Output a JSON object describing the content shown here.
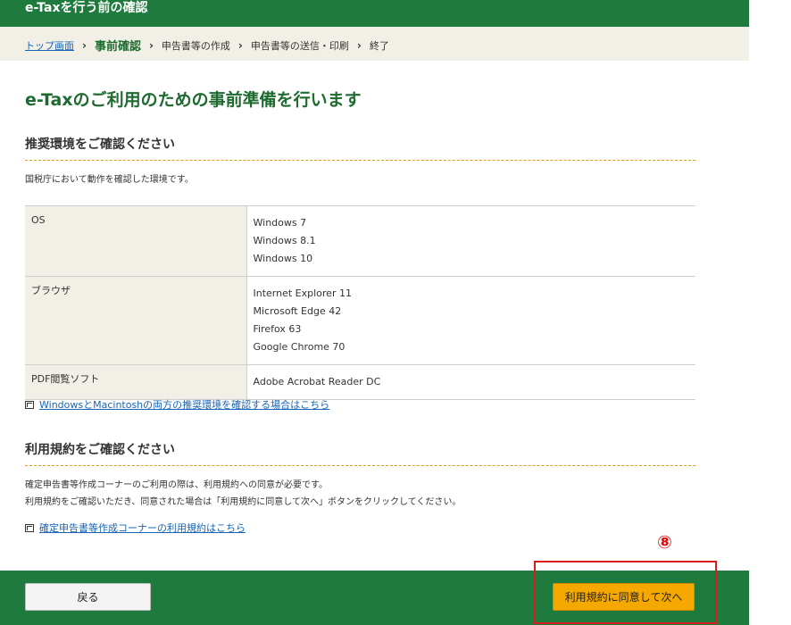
{
  "header": {
    "title": "e-Taxを行う前の確認"
  },
  "breadcrumb": {
    "top_link": "トップ画面",
    "current": "事前確認",
    "step2": "申告書等の作成",
    "step3": "申告書等の送信・印刷",
    "step4": "終了",
    "separator": "›"
  },
  "page": {
    "title": "e-Taxのご利用のための事前準備を行います"
  },
  "env_section": {
    "title": "推奨環境をご確認ください",
    "description": "国税庁において動作を確認した環境です。",
    "rows": [
      {
        "key": "OS",
        "values": [
          "Windows 7",
          "Windows 8.1",
          "Windows 10"
        ]
      },
      {
        "key": "ブラウザ",
        "values": [
          "Internet Explorer 11",
          "Microsoft Edge 42",
          "Firefox 63",
          "Google Chrome 70"
        ]
      },
      {
        "key": "PDF閲覧ソフト",
        "values": [
          "Adobe Acrobat Reader DC"
        ]
      }
    ],
    "link": "WindowsとMacintoshの両方の推奨環境を確認する場合はこちら"
  },
  "terms_section": {
    "title": "利用規約をご確認ください",
    "line1": "確定申告書等作成コーナーのご利用の際は、利用規約への同意が必要です。",
    "line2": "利用規約をご確認いただき、同意された場合は「利用規約に同意して次へ」ボタンをクリックしてください。",
    "link": "確定申告書等作成コーナーの利用規約はこちら"
  },
  "annotation": {
    "marker": "⑧"
  },
  "footer": {
    "back_label": "戻る",
    "next_label": "利用規約に同意して次へ"
  },
  "colors": {
    "brand_green": "#1e7b3d",
    "accent_orange": "#f5a800",
    "link_blue": "#1a64b5",
    "highlight_red": "#d81c1c"
  }
}
